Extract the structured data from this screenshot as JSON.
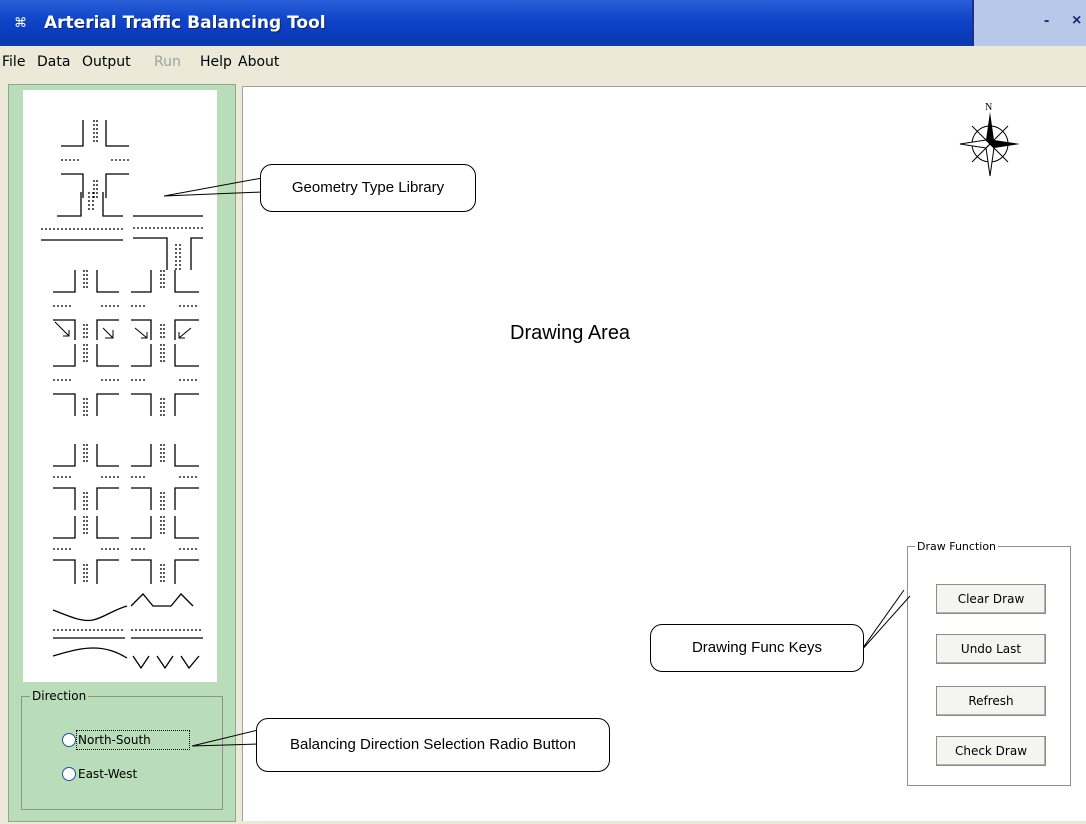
{
  "window": {
    "title": "Arterial Traffic Balancing Tool",
    "minimize_glyph": "-",
    "close_glyph": "×",
    "app_icon_glyph": "⌘"
  },
  "menu": [
    {
      "label": "File",
      "enabled": true
    },
    {
      "label": "Data",
      "enabled": true
    },
    {
      "label": "Output",
      "enabled": true
    },
    {
      "label": "Run",
      "enabled": false
    },
    {
      "label": "Help",
      "enabled": true
    },
    {
      "label": "About",
      "enabled": true
    }
  ],
  "direction": {
    "legend": "Direction",
    "options": [
      {
        "label": "North-South",
        "selected": false
      },
      {
        "label": "East-West",
        "selected": false
      }
    ]
  },
  "drawing": {
    "label": "Drawing Area",
    "compass_label": "N"
  },
  "draw_function": {
    "legend": "Draw Function",
    "buttons": [
      "Clear Draw",
      "Undo Last",
      "Refresh",
      "Check Draw"
    ]
  },
  "callouts": {
    "geometry": "Geometry Type Library",
    "balancing": "Balancing Direction Selection Radio Button",
    "func_keys": "Drawing Func Keys"
  },
  "colors": {
    "titlebar": "#0a3cc0",
    "sidebar": "#b9dcb9",
    "menu_disabled": "#a0a0a0"
  }
}
